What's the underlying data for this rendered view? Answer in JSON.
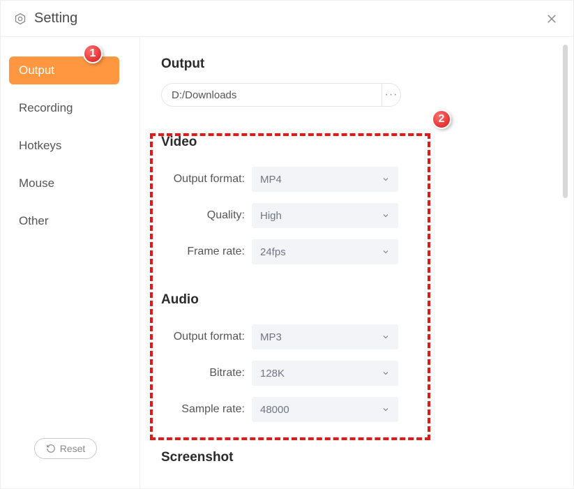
{
  "header": {
    "title": "Setting"
  },
  "sidebar": {
    "items": [
      {
        "label": "Output",
        "active": true
      },
      {
        "label": "Recording",
        "active": false
      },
      {
        "label": "Hotkeys",
        "active": false
      },
      {
        "label": "Mouse",
        "active": false
      },
      {
        "label": "Other",
        "active": false
      }
    ],
    "reset_label": "Reset"
  },
  "content": {
    "output_section": {
      "title": "Output",
      "path": "D:/Downloads"
    },
    "video_section": {
      "title": "Video",
      "output_format_label": "Output format:",
      "output_format_value": "MP4",
      "quality_label": "Quality:",
      "quality_value": "High",
      "frame_rate_label": "Frame rate:",
      "frame_rate_value": "24fps"
    },
    "audio_section": {
      "title": "Audio",
      "output_format_label": "Output format:",
      "output_format_value": "MP3",
      "bitrate_label": "Bitrate:",
      "bitrate_value": "128K",
      "sample_rate_label": "Sample rate:",
      "sample_rate_value": "48000"
    },
    "screenshot_section": {
      "title": "Screenshot"
    }
  },
  "annotations": {
    "badge1": "1",
    "badge2": "2"
  }
}
